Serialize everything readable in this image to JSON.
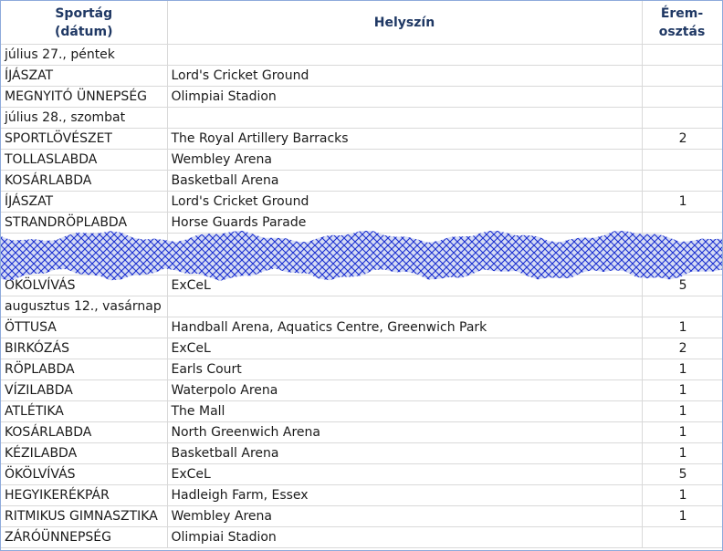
{
  "headers": {
    "sport_line1": "Sportág",
    "sport_line2": "(dátum)",
    "venue": "Helyszín",
    "medals_line1": "Érem-",
    "medals_line2": "osztás"
  },
  "rows_top": [
    {
      "type": "date",
      "sport": "július 27., péntek",
      "venue": "",
      "medals": ""
    },
    {
      "type": "event",
      "sport": "ÍJÁSZAT",
      "venue": "Lord's Cricket Ground",
      "medals": ""
    },
    {
      "type": "event",
      "sport": "MEGNYITÓ ÜNNEPSÉG",
      "venue": "Olimpiai Stadion",
      "medals": ""
    },
    {
      "type": "date",
      "sport": "július 28., szombat",
      "venue": "",
      "medals": ""
    },
    {
      "type": "event",
      "sport": "SPORTLÖVÉSZET",
      "venue": "The Royal Artillery Barracks",
      "medals": "2"
    },
    {
      "type": "event",
      "sport": "TOLLASLABDA",
      "venue": "Wembley Arena",
      "medals": ""
    },
    {
      "type": "event",
      "sport": "KOSÁRLABDA",
      "venue": "Basketball Arena",
      "medals": ""
    },
    {
      "type": "event",
      "sport": "ÍJÁSZAT",
      "venue": "Lord's Cricket Ground",
      "medals": "1"
    },
    {
      "type": "event",
      "sport": "STRANDRÖPLABDA",
      "venue": "Horse Guards Parade",
      "medals": ""
    }
  ],
  "rows_bottom": [
    {
      "type": "event",
      "sport": "ÖKÖLVÍVÁS",
      "venue": "ExCeL",
      "medals": "5"
    },
    {
      "type": "date",
      "sport": "augusztus 12., vasárnap",
      "venue": "",
      "medals": ""
    },
    {
      "type": "event",
      "sport": "ÖTTUSA",
      "venue": "Handball Arena, Aquatics Centre, Greenwich Park",
      "medals": "1"
    },
    {
      "type": "event",
      "sport": "BIRKÓZÁS",
      "venue": "ExCeL",
      "medals": "2"
    },
    {
      "type": "event",
      "sport": "RÖPLABDA",
      "venue": "Earls Court",
      "medals": "1"
    },
    {
      "type": "event",
      "sport": "VÍZILABDA",
      "venue": "Waterpolo Arena",
      "medals": "1"
    },
    {
      "type": "event",
      "sport": "ATLÉTIKA",
      "venue": "The Mall",
      "medals": "1"
    },
    {
      "type": "event",
      "sport": "KOSÁRLABDA",
      "venue": "North Greenwich Arena",
      "medals": "1"
    },
    {
      "type": "event",
      "sport": "KÉZILABDA",
      "venue": "Basketball Arena",
      "medals": "1"
    },
    {
      "type": "event",
      "sport": "ÖKÖLVÍVÁS",
      "venue": "ExCeL",
      "medals": "5"
    },
    {
      "type": "event",
      "sport": "HEGYIKERÉKPÁR",
      "venue": "Hadleigh Farm, Essex",
      "medals": "1"
    },
    {
      "type": "event",
      "sport": "RITMIKUS GIMNASZTIKA",
      "venue": "Wembley Arena",
      "medals": "1"
    },
    {
      "type": "event",
      "sport": "ZÁRÓÜNNEPSÉG",
      "venue": "Olimpiai Stadion",
      "medals": ""
    }
  ],
  "colors": {
    "header_text": "#1f3864",
    "grid": "#d9d9d9",
    "frame": "#8eaadb",
    "break_pattern": "#1a2fd0"
  }
}
